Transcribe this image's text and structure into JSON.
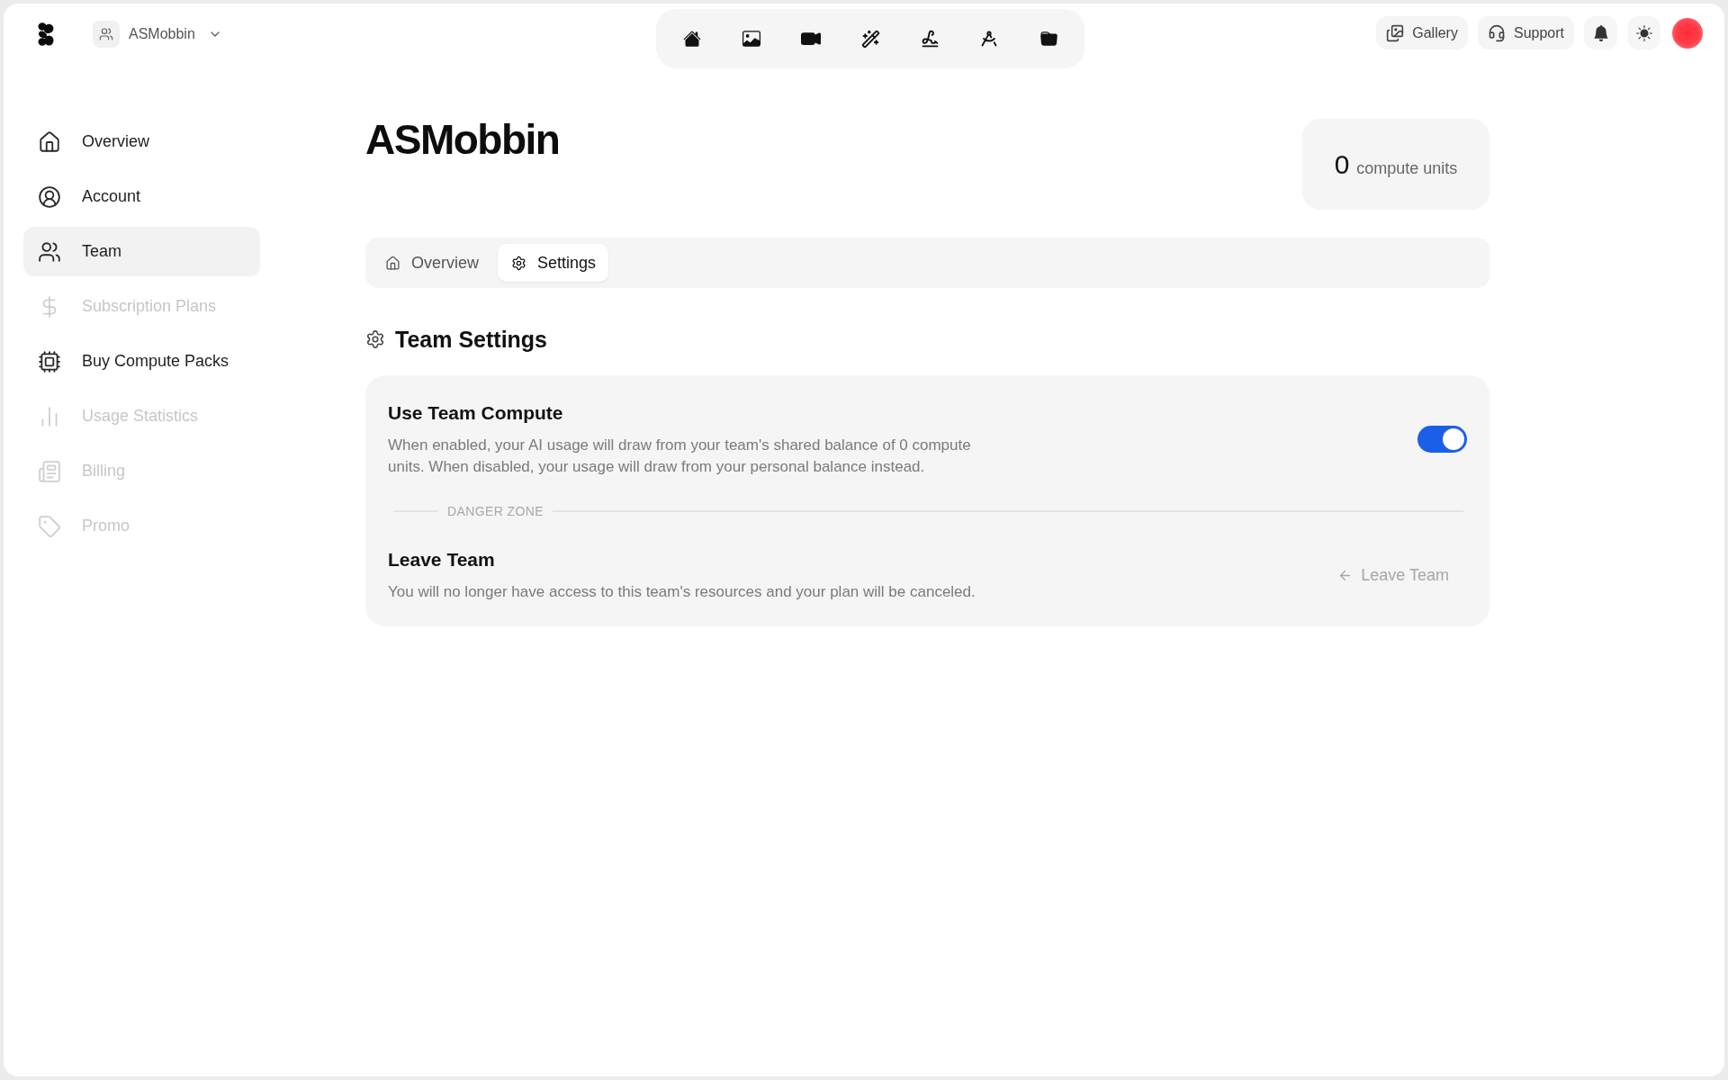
{
  "header": {
    "team_switcher": {
      "name": "ASMobbin"
    },
    "actions": [
      {
        "label": "Gallery"
      },
      {
        "label": "Support"
      }
    ]
  },
  "sidebar": {
    "items": [
      {
        "label": "Overview",
        "selected": false,
        "disabled": false
      },
      {
        "label": "Account",
        "selected": false,
        "disabled": false
      },
      {
        "label": "Team",
        "selected": true,
        "disabled": false
      },
      {
        "label": "Subscription Plans",
        "selected": false,
        "disabled": true
      },
      {
        "label": "Buy Compute Packs",
        "selected": false,
        "disabled": false
      },
      {
        "label": "Usage Statistics",
        "selected": false,
        "disabled": true
      },
      {
        "label": "Billing",
        "selected": false,
        "disabled": true
      },
      {
        "label": "Promo",
        "selected": false,
        "disabled": true
      }
    ]
  },
  "page": {
    "title": "ASMobbin",
    "balance": {
      "amount": "0",
      "unit": "compute units"
    }
  },
  "tabs": [
    {
      "label": "Overview",
      "selected": false
    },
    {
      "label": "Settings",
      "selected": true
    }
  ],
  "team_settings": {
    "title": "Team Settings",
    "team_compute": {
      "title": "Use Team Compute",
      "description": "When enabled, your AI usage will draw from your team's shared balance of 0 compute units. When disabled, your usage will draw from your personal balance instead.",
      "on": true
    },
    "danger_zone": {
      "label": "DANGER ZONE"
    },
    "leave_team": {
      "title": "Leave Team",
      "description": "You will no longer have access to this team's resources and your plan will be canceled.",
      "button": {
        "label": "Leave Team",
        "disabled": true
      }
    }
  }
}
